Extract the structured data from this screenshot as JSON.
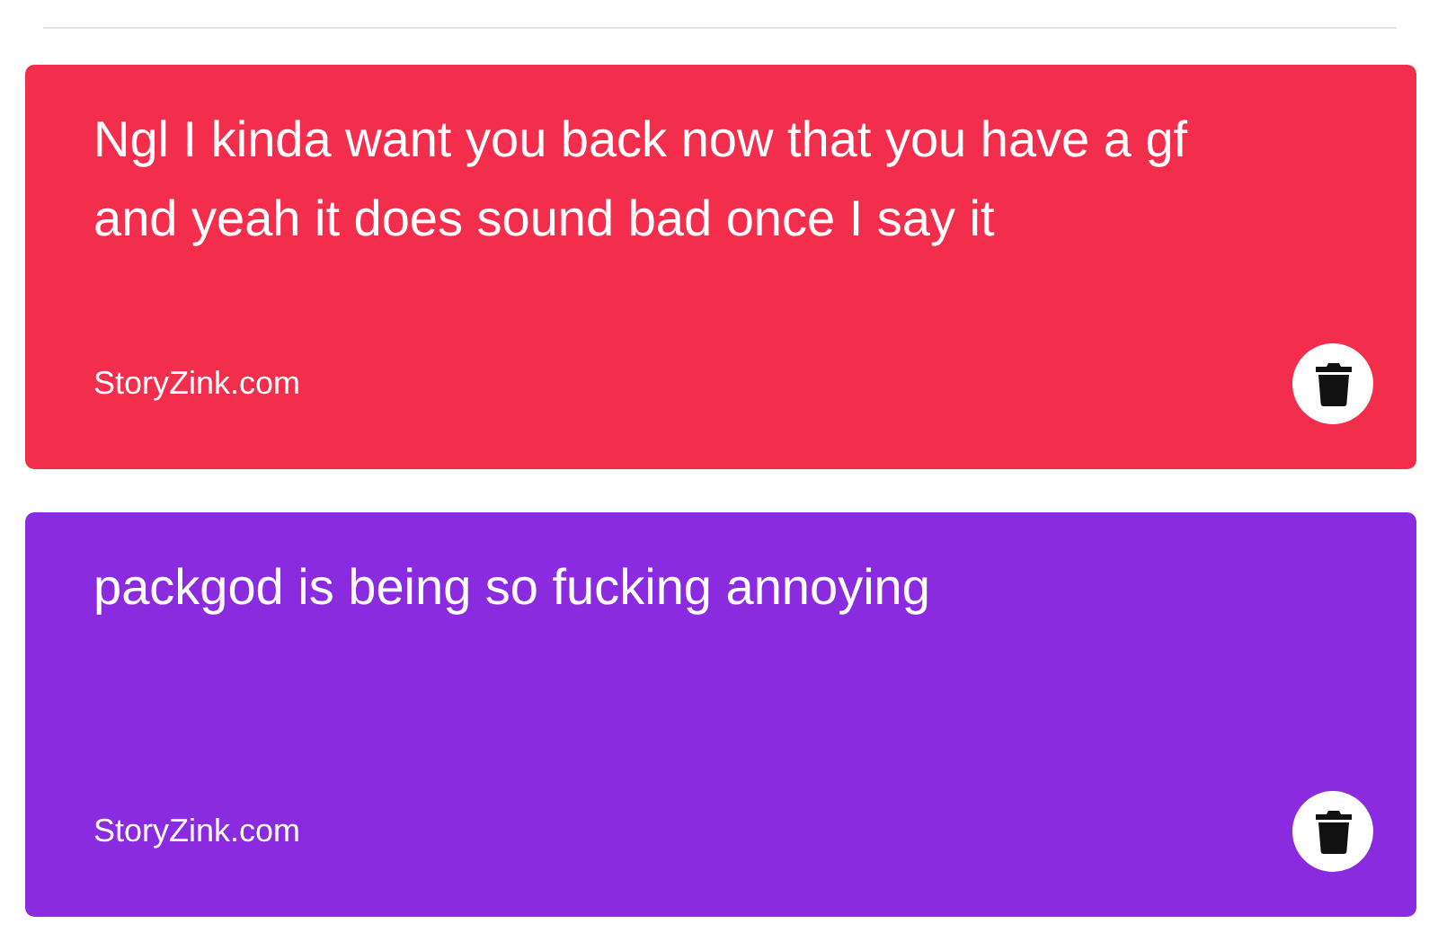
{
  "posts": [
    {
      "text": "Ngl I kinda want you back now that you have a gf and yeah it does sound bad once I say it",
      "source": "StoryZink.com",
      "color": "#f22e4c"
    },
    {
      "text": "packgod is being so fucking annoying",
      "source": "StoryZink.com",
      "color": "#8a2be0"
    }
  ]
}
